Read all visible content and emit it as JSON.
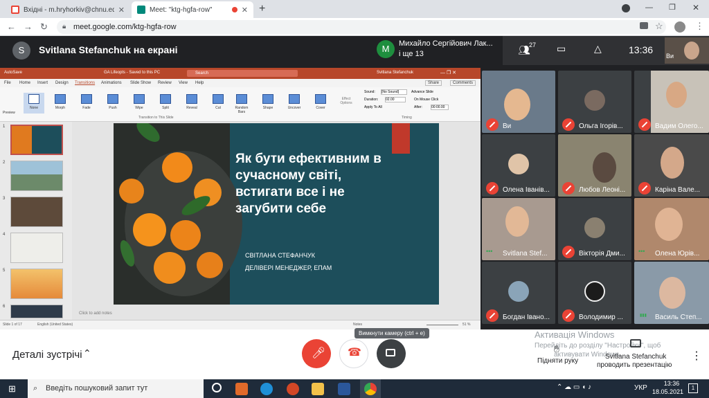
{
  "browser": {
    "tabs": [
      {
        "title": "Вхідні - m.hryhorkiv@chnu.edu.ua",
        "favicon": "gmail-icon",
        "active": false
      },
      {
        "title": "Meet: \"ktg-hgfa-row\"",
        "favicon": "meet-icon",
        "active": true
      }
    ],
    "url": "meet.google.com/ktg-hgfa-row",
    "new_tab": "+"
  },
  "meet": {
    "presenter_initial": "S",
    "presenter_banner": "Svitlana Stefanchuk на екрані",
    "pinned_initial": "М",
    "pinned_name": "Михайло Сергійович Лак...",
    "pinned_more": "і ще 13",
    "people_count": "27",
    "clock": "13:36",
    "self_label": "Ви"
  },
  "powerpoint": {
    "title_center": "GA Lifeopts - Saved to this PC",
    "user": "Svitlana Stefanchuk",
    "search_placeholder": "Search",
    "autosave": "AutoSave",
    "menu": [
      "File",
      "Home",
      "Insert",
      "Design",
      "Transitions",
      "Animations",
      "Slide Show",
      "Review",
      "View",
      "Help"
    ],
    "share": "Share",
    "comments": "Comments",
    "transitions": [
      "None",
      "Morph",
      "Fade",
      "Push",
      "Wipe",
      "Split",
      "Reveal",
      "Cut",
      "Random Bars",
      "Shape",
      "Uncover",
      "Cover"
    ],
    "preview": "Preview",
    "effect_options": "Effect Options",
    "group_label": "Transition to This Slide",
    "timing_label": "Timing",
    "sound": "Sound:",
    "sound_value": "[No Sound]",
    "duration": "Duration:",
    "duration_value": "02.00",
    "apply_all": "Apply To All",
    "advance": "Advance Slide",
    "on_click": "On Mouse Click",
    "after": "After:",
    "after_value": "00:00.00",
    "thumb_numbers": [
      "1",
      "2",
      "3",
      "4",
      "5",
      "6"
    ],
    "slide_title": "Як бути ефективним в сучасному світі, встигати все і не загубити себе",
    "slide_author": "СВІТЛАНА СТЕФАНЧУК",
    "slide_role": "ДЕЛІВЕРІ МЕНЕДЖЕР, ЕПАМ",
    "notes": "Click to add notes",
    "status_left": "Slide 1 of 17",
    "status_lang": "English (United States)",
    "status_notes": "Notes",
    "zoom": "51 %"
  },
  "participants": [
    {
      "name": "Ви",
      "status": "muted",
      "bg": "#6a7a8a"
    },
    {
      "name": "Ольга Ігорів...",
      "status": "muted",
      "bg": "#3c4043"
    },
    {
      "name": "Вадим Олего...",
      "status": "muted",
      "bg": "#c8c2b8"
    },
    {
      "name": "Олена Іванів...",
      "status": "muted",
      "bg": "#3c4043"
    },
    {
      "name": "Любов Леоні...",
      "status": "muted",
      "bg": "#8a8470"
    },
    {
      "name": "Каріна Вале...",
      "status": "muted",
      "bg": "#4a4a4a"
    },
    {
      "name": "Svitlana Stef...",
      "status": "dots",
      "bg": "#a89a90"
    },
    {
      "name": "Вікторія Дми...",
      "status": "muted",
      "bg": "#3c4043"
    },
    {
      "name": "Олена Юрів...",
      "status": "dots",
      "bg": "#b0886c"
    },
    {
      "name": "Богдан Івано...",
      "status": "muted",
      "bg": "#3c4043"
    },
    {
      "name": "Володимир ...",
      "status": "muted",
      "bg": "#3c4043"
    },
    {
      "name": "Василь Степ...",
      "status": "talk",
      "bg": "#8a9aa8"
    }
  ],
  "controls": {
    "details": "Деталі зустрічі",
    "tooltip": "Вимкнути камеру (ctrl + e)",
    "raise_hand": "Підняти руку",
    "presenting_name": "Svitlana Stefanchuk",
    "presenting_text": "проводить презентацію",
    "watermark_line1": "Активація Windows",
    "watermark_line2": "Перейдіть до розділу \"Настройки\", щоб",
    "watermark_line3": "активувати Windows."
  },
  "taskbar": {
    "search_placeholder": "Введіть пошуковий запит тут",
    "lang": "УКР",
    "time": "13:36",
    "date": "18.05.2021",
    "notifications": "1"
  },
  "colors": {
    "meet_bg": "#202124",
    "danger": "#ea4335",
    "ppt_red": "#b7472a",
    "slide_teal": "#1d4e5b",
    "slide_accent": "#c0392b"
  }
}
